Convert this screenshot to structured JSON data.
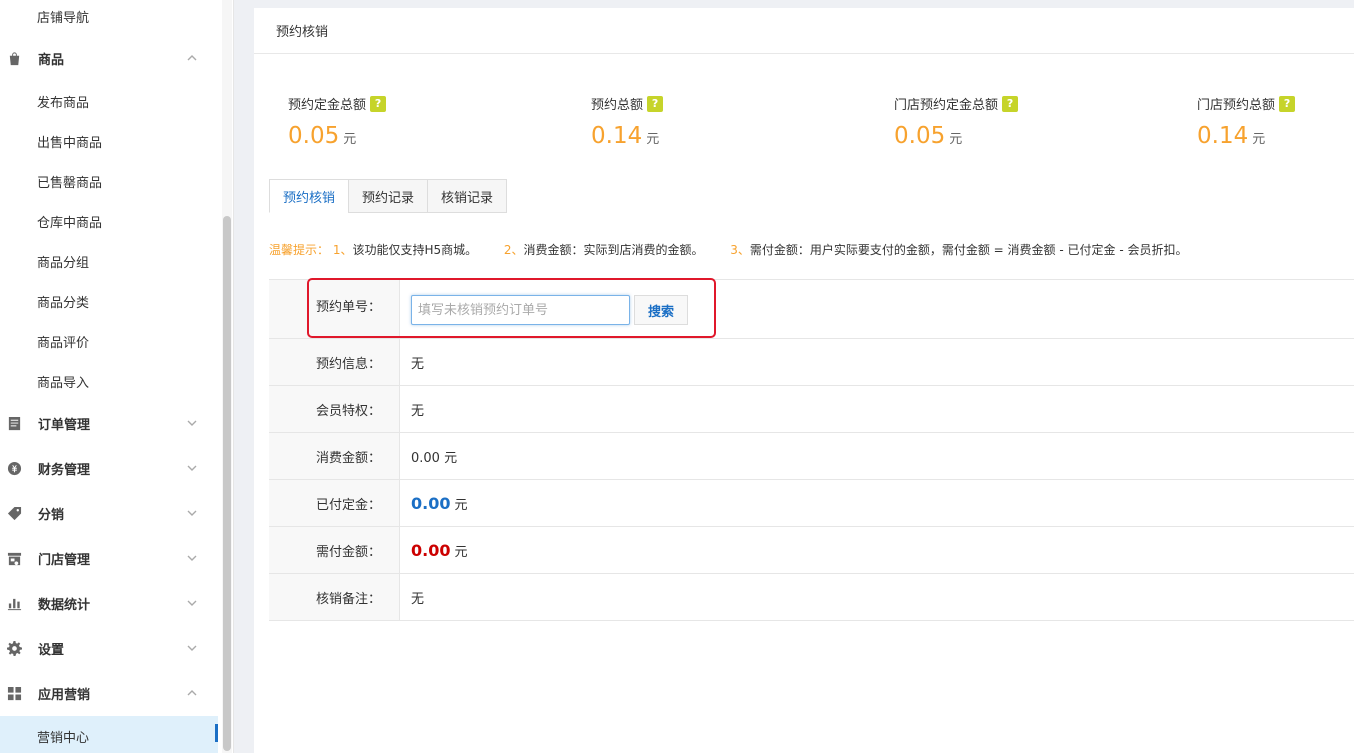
{
  "sidebar": {
    "top_item": "店铺导航",
    "goods_group": "商品",
    "goods_items": [
      "发布商品",
      "出售中商品",
      "已售罄商品",
      "仓库中商品",
      "商品分组",
      "商品分类",
      "商品评价",
      "商品导入"
    ],
    "groups": [
      {
        "label": "订单管理",
        "icon": "order-icon"
      },
      {
        "label": "财务管理",
        "icon": "finance-icon"
      },
      {
        "label": "分销",
        "icon": "tag-icon"
      },
      {
        "label": "门店管理",
        "icon": "store-icon"
      },
      {
        "label": "数据统计",
        "icon": "bar-chart-icon"
      },
      {
        "label": "设置",
        "icon": "gear-icon"
      },
      {
        "label": "应用营销",
        "icon": "apps-icon"
      }
    ],
    "active_item": "营销中心"
  },
  "page": {
    "title": "预约核销"
  },
  "stats": [
    {
      "label": "预约定金总额",
      "value": "0.05",
      "unit": "元"
    },
    {
      "label": "预约总额",
      "value": "0.14",
      "unit": "元"
    },
    {
      "label": "门店预约定金总额",
      "value": "0.05",
      "unit": "元"
    },
    {
      "label": "门店预约总额",
      "value": "0.14",
      "unit": "元"
    }
  ],
  "qmark": "?",
  "tabs": [
    "预约核销",
    "预约记录",
    "核销记录"
  ],
  "tip": {
    "prefix": "温馨提示：",
    "n1": "1、",
    "t1": "该功能仅支持H5商城。",
    "n2": "2、",
    "t2": "消费金额：实际到店消费的金额。",
    "n3": "3、",
    "t3": "需付金额：用户实际要支付的金额，需付金额 = 消费金额 - 已付定金 - 会员折扣。"
  },
  "form": {
    "order_no_label": "预约单号：",
    "order_no_placeholder": "填写未核销预约订单号",
    "search_label": "搜索",
    "info_label": "预约信息：",
    "info_value": "无",
    "privilege_label": "会员特权：",
    "privilege_value": "无",
    "consume_label": "消费金额：",
    "consume_value": "0.00 元",
    "paid_label": "已付定金：",
    "paid_value": "0.00",
    "need_label": "需付金额：",
    "need_value": "0.00",
    "remark_label": "核销备注：",
    "remark_value": "无",
    "unit": "元"
  },
  "colors": {
    "accent": "#1b6fc5",
    "orange": "#f7a22e",
    "red": "#cc0000",
    "highlight": "#e0182b"
  }
}
